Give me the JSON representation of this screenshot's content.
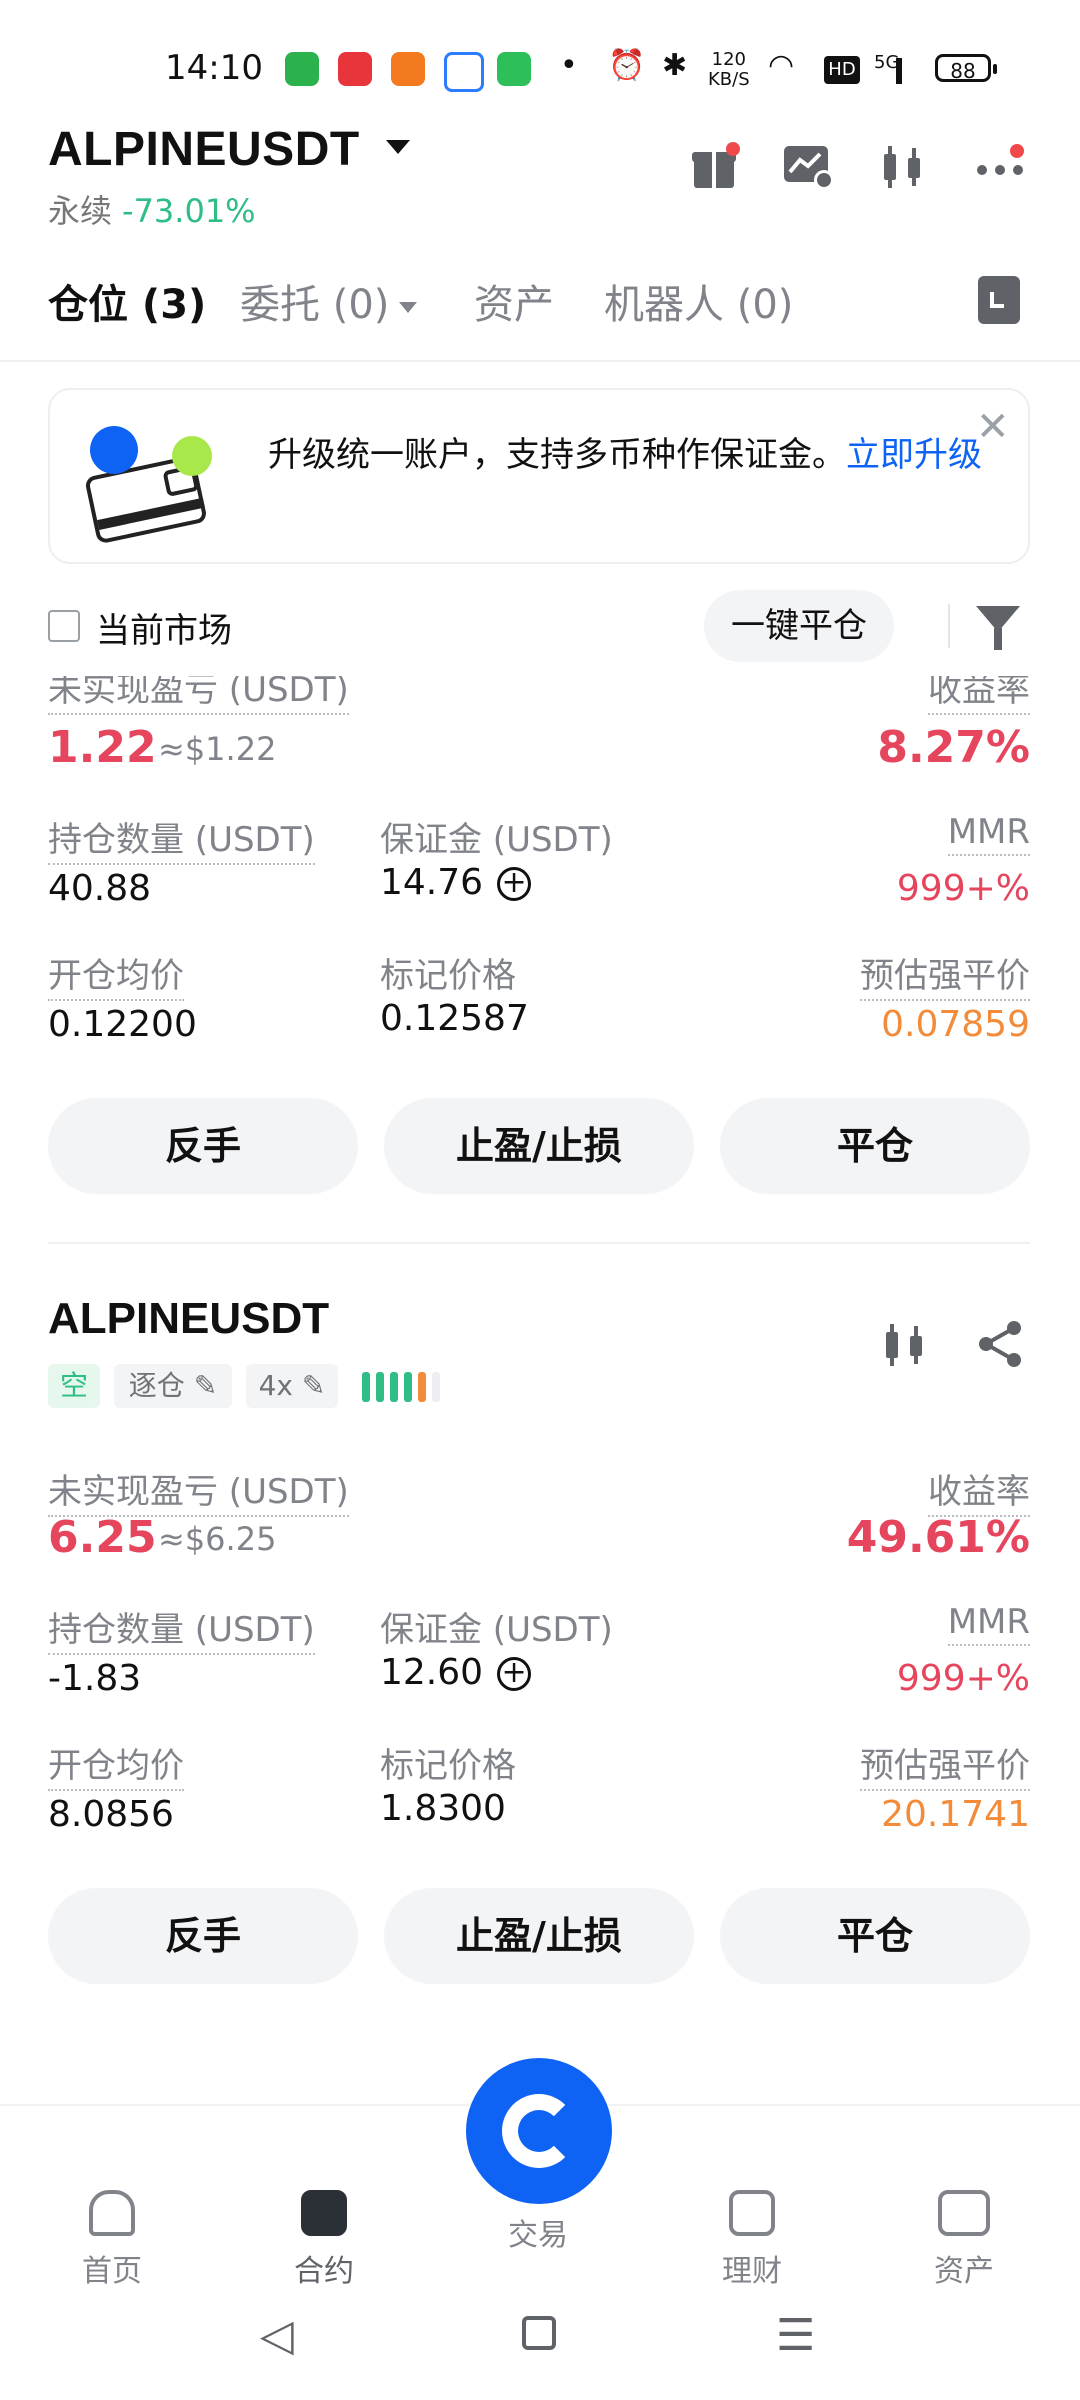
{
  "status_bar": {
    "time": "14:10",
    "network_speed_top": "120",
    "network_speed_unit": "KB/S",
    "hd": "HD",
    "signal": "5G",
    "battery": "88"
  },
  "header": {
    "symbol": "ALPINEUSDT",
    "contract_type": "永续",
    "change_pct": "-73.01%",
    "icons": [
      "gift-icon",
      "chart-alert-icon",
      "candlestick-icon",
      "more-icon"
    ]
  },
  "tabs": [
    {
      "label": "仓位 (3)",
      "active": true
    },
    {
      "label": "委托 (0)",
      "active": false,
      "has_dropdown": true
    },
    {
      "label": "资产",
      "active": false
    },
    {
      "label": "机器人 (0)",
      "active": false
    }
  ],
  "banner": {
    "text": "升级统一账户，支持多币种作保证金。",
    "link": "立即升级"
  },
  "filter": {
    "current_market_label": "当前市场",
    "close_all_label": "一键平仓"
  },
  "labels": {
    "unrealized_pnl": "未实现盈亏 (USDT)",
    "roe": "收益率",
    "position_size": "持仓数量 (USDT)",
    "margin": "保证金 (USDT)",
    "mmr": "MMR",
    "entry_price": "开仓均价",
    "mark_price": "标记价格",
    "liq_price": "预估强平价",
    "reverse": "反手",
    "tpsl": "止盈/止损",
    "close": "平仓"
  },
  "positions": [
    {
      "pnl": "1.22",
      "pnl_usd": "≈$1.22",
      "roe": "8.27%",
      "size": "40.88",
      "margin": "14.76",
      "mmr": "999+%",
      "entry": "0.12200",
      "mark": "0.12587",
      "liq": "0.07859"
    },
    {
      "symbol": "ALPINEUSDT",
      "side": "空",
      "margin_mode": "逐仓",
      "leverage": "4x",
      "pnl": "6.25",
      "pnl_usd": "≈$6.25",
      "roe": "49.61%",
      "size": "-1.83",
      "margin": "12.60",
      "mmr": "999+%",
      "entry": "8.0856",
      "mark": "1.8300",
      "liq": "20.1741"
    }
  ],
  "colors": {
    "accent": "#0e63f4",
    "loss_red": "#e5455d",
    "gain_green": "#2dbd85",
    "liq_orange": "#f28c3a"
  },
  "bottom_nav": [
    {
      "label": "首页",
      "icon": "home-icon"
    },
    {
      "label": "合约",
      "icon": "futures-icon",
      "active": true
    },
    {
      "label": "交易",
      "icon": "trade-icon"
    },
    {
      "label": "理财",
      "icon": "earn-icon"
    },
    {
      "label": "资产",
      "icon": "wallet-icon"
    }
  ]
}
